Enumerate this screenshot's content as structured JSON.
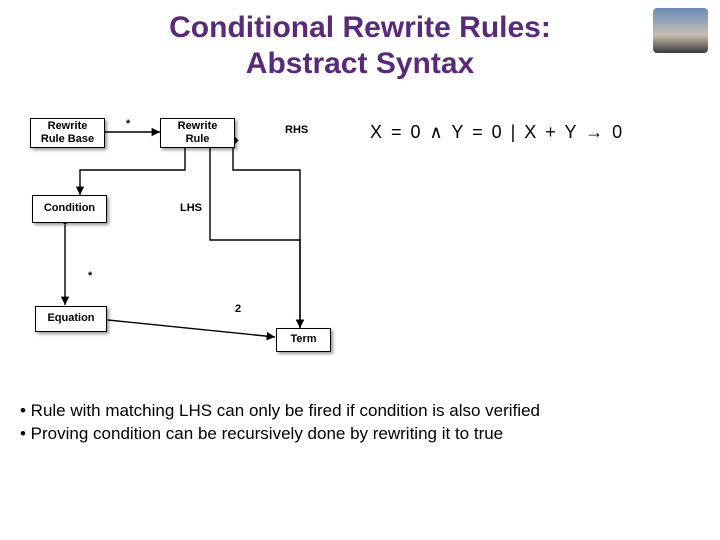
{
  "title_line1": "Conditional Rewrite Rules:",
  "title_line2": "Abstract Syntax",
  "nodes": {
    "rewrite_rule_base": "Rewrite Rule Base",
    "rewrite_rule": "Rewrite Rule",
    "condition": "Condition",
    "equation": "Equation",
    "term": "Term"
  },
  "edge_labels": {
    "star1": "*",
    "star2": "*",
    "rhs": "RHS",
    "lhs": "LHS",
    "two": "2"
  },
  "example": "X = 0  ∧  Y = 0 | X + Y → 0",
  "bullet1": "• Rule with matching LHS can only be fired if condition is also verified",
  "bullet2": "• Proving condition can be recursively done by rewriting it to true"
}
